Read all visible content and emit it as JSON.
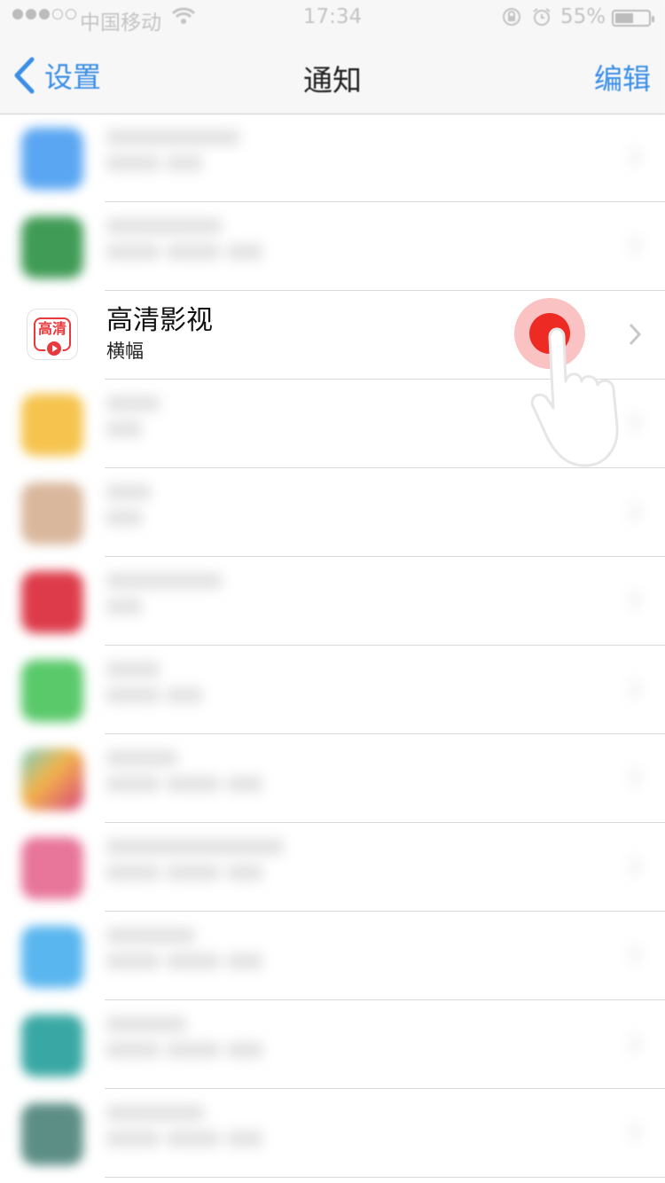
{
  "status": {
    "carrier": "中国移动",
    "time": "17:34",
    "battery": "55%",
    "battery_level": 0.55
  },
  "nav": {
    "back_label": "设置",
    "title": "通知",
    "edit_label": "编辑"
  },
  "list": {
    "focused_app": {
      "name": "高清影视",
      "style": "横幅",
      "icon_label": "高清"
    }
  },
  "colors": {
    "accent": "#3a8ee6",
    "tap": "#ee2a24",
    "app_red": "#e8393c"
  }
}
